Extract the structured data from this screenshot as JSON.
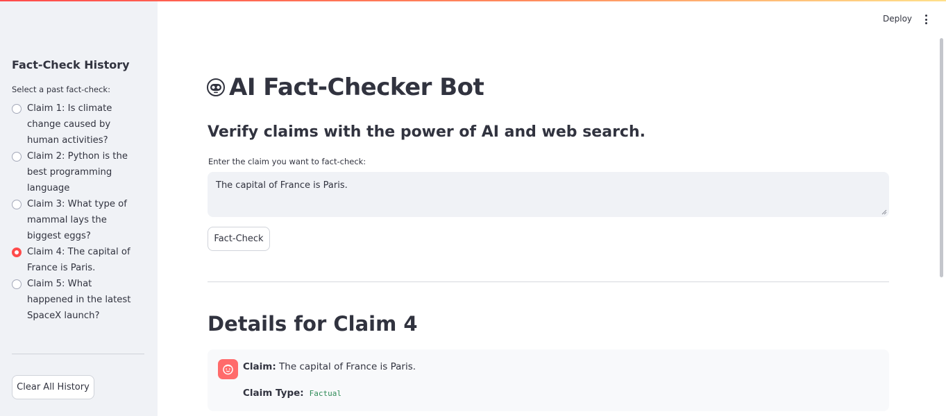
{
  "colors": {
    "accent": "#ff4b4b",
    "sidebar_bg": "#f0f2f6",
    "code_green": "#2e8b57"
  },
  "header": {
    "deploy_label": "Deploy",
    "menu_icon": "kebab-menu-icon"
  },
  "sidebar": {
    "title": "Fact-Check History",
    "subtitle": "Select a past fact-check:",
    "items": [
      {
        "label": "Claim 1: Is climate change caused by human activities?",
        "selected": false
      },
      {
        "label": "Claim 2: Python is the best programming language",
        "selected": false
      },
      {
        "label": "Claim 3: What type of mammal lays the biggest eggs?",
        "selected": false
      },
      {
        "label": "Claim 4: The capital of France is Paris.",
        "selected": true
      },
      {
        "label": "Claim 5: What happened in the latest SpaceX launch?",
        "selected": false
      }
    ],
    "clear_button": "Clear All History"
  },
  "main": {
    "title": "AI Fact-Checker Bot",
    "title_icon": "robot-face-icon",
    "subtitle": "Verify claims with the power of AI and web search.",
    "input_label": "Enter the claim you want to fact-check:",
    "input_value": "The capital of France is Paris.",
    "fact_check_button": "Fact-Check",
    "details_title": "Details for Claim 4",
    "details": {
      "claim_label": "Claim:",
      "claim_value": "The capital of France is Paris.",
      "type_label": "Claim Type:",
      "type_value": "Factual"
    }
  }
}
